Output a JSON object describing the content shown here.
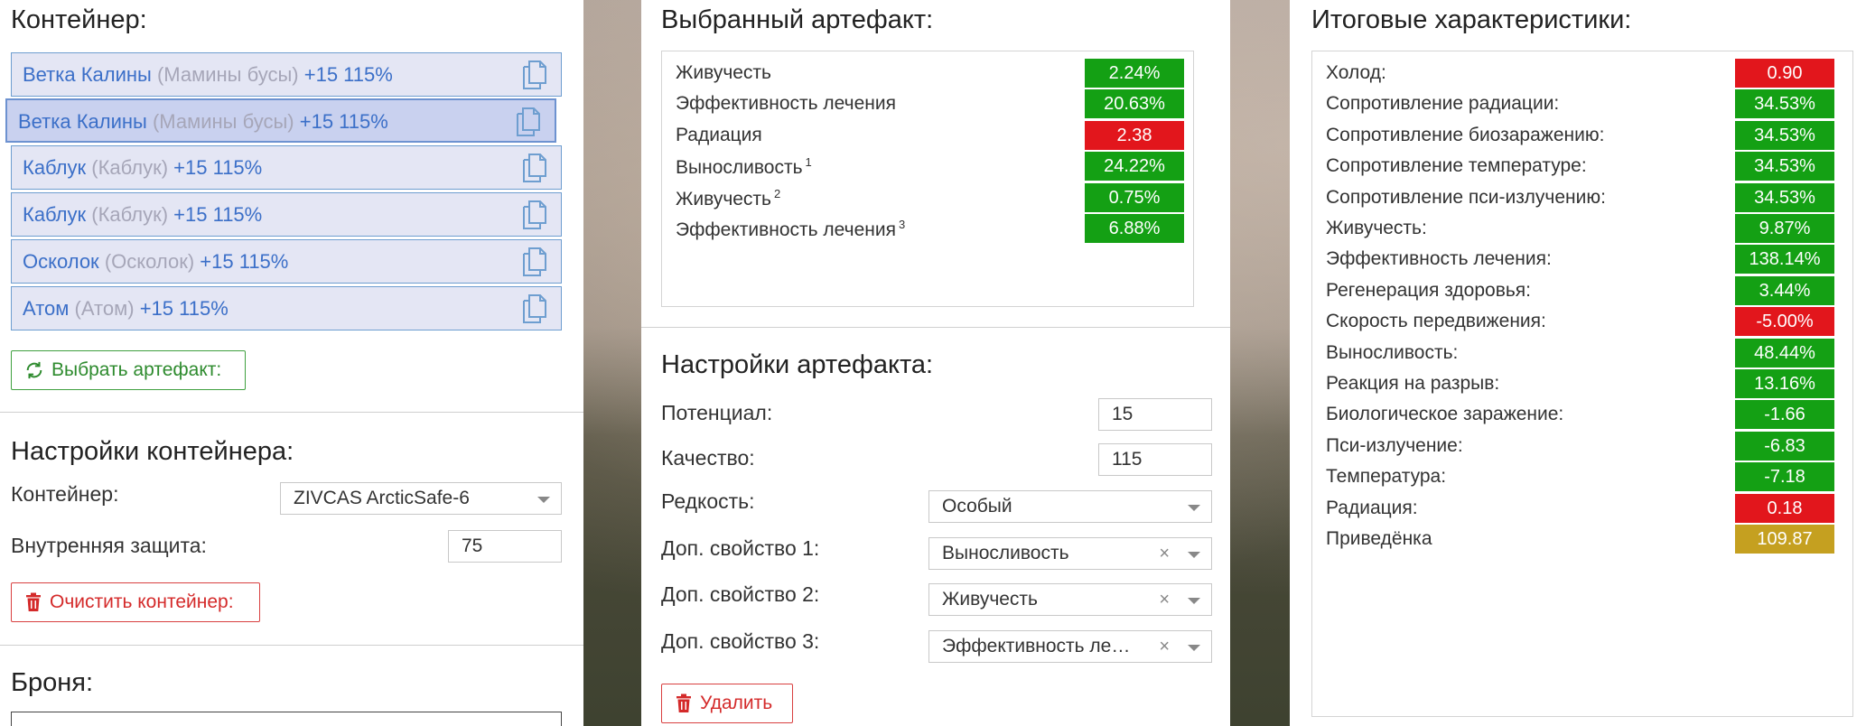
{
  "colors": {
    "positive": "#14a014",
    "negative": "#e2161c",
    "neutral": "#c5a020",
    "link": "#3b6fc8"
  },
  "container_panel": {
    "title": "Контейнер:",
    "items": [
      {
        "name": "Ветка Калины",
        "original": "(Мамины бусы)",
        "level": "+15 115%",
        "icon": "copy-icon"
      },
      {
        "name": "Ветка Калины",
        "original": "(Мамины бусы)",
        "level": "+15 115%",
        "icon": "copy-icon"
      },
      {
        "name": "Каблук",
        "original": "(Каблук)",
        "level": "+15 115%",
        "icon": "copy-icon"
      },
      {
        "name": "Каблук",
        "original": "(Каблук)",
        "level": "+15 115%",
        "icon": "copy-icon"
      },
      {
        "name": "Осколок",
        "original": "(Осколок)",
        "level": "+15 115%",
        "icon": "copy-icon"
      },
      {
        "name": "Атом",
        "original": "(Атом)",
        "level": "+15 115%",
        "icon": "copy-icon"
      }
    ],
    "select_button": "Выбрать артефакт:",
    "settings_title": "Настройки контейнера:",
    "container_label": "Контейнер:",
    "container_value": "ZIVCAS ArcticSafe-6",
    "protection_label": "Внутренняя защита:",
    "protection_value": "75",
    "clear_button": "Очистить контейнер:",
    "armor_title": "Броня:"
  },
  "artifact_panel": {
    "title": "Выбранный артефакт:",
    "stats": [
      {
        "name": "Живучесть",
        "sup": "",
        "value": "2.24%",
        "tone": "g"
      },
      {
        "name": "Эффективность лечения",
        "sup": "",
        "value": "20.63%",
        "tone": "g"
      },
      {
        "name": "Радиация",
        "sup": "",
        "value": "2.38",
        "tone": "r"
      },
      {
        "name": "Выносливость",
        "sup": "1",
        "value": "24.22%",
        "tone": "g"
      },
      {
        "name": "Живучесть",
        "sup": "2",
        "value": "0.75%",
        "tone": "g"
      },
      {
        "name": "Эффективность лечения",
        "sup": "3",
        "value": "6.88%",
        "tone": "g"
      }
    ],
    "settings_title": "Настройки артефакта:",
    "potential_label": "Потенциал:",
    "potential_value": "15",
    "quality_label": "Качество:",
    "quality_value": "115",
    "rarity_label": "Редкость:",
    "rarity_value": "Особый",
    "prop1_label": "Доп. свойство 1:",
    "prop1_value": "Выносливость",
    "prop2_label": "Доп. свойство 2:",
    "prop2_value": "Живучесть",
    "prop3_label": "Доп. свойство 3:",
    "prop3_value": "Эффективность ле…",
    "clear_x": "×",
    "delete_button": "Удалить"
  },
  "totals_panel": {
    "title": "Итоговые характеристики:",
    "stats": [
      {
        "name": "Холод:",
        "value": "0.90",
        "tone": "r"
      },
      {
        "name": "Сопротивление радиации:",
        "value": "34.53%",
        "tone": "g"
      },
      {
        "name": "Сопротивление биозаражению:",
        "value": "34.53%",
        "tone": "g"
      },
      {
        "name": "Сопротивление температуре:",
        "value": "34.53%",
        "tone": "g"
      },
      {
        "name": "Сопротивление пси-излучению:",
        "value": "34.53%",
        "tone": "g"
      },
      {
        "name": "Живучесть:",
        "value": "9.87%",
        "tone": "g"
      },
      {
        "name": "Эффективность лечения:",
        "value": "138.14%",
        "tone": "g"
      },
      {
        "name": "Регенерация здоровья:",
        "value": "3.44%",
        "tone": "g"
      },
      {
        "name": "Скорость передвижения:",
        "value": "-5.00%",
        "tone": "r"
      },
      {
        "name": "Выносливость:",
        "value": "48.44%",
        "tone": "g"
      },
      {
        "name": "Реакция на разрыв:",
        "value": "13.16%",
        "tone": "g"
      },
      {
        "name": "Биологическое заражение:",
        "value": "-1.66",
        "tone": "g"
      },
      {
        "name": "Пси-излучение:",
        "value": "-6.83",
        "tone": "g"
      },
      {
        "name": "Температура:",
        "value": "-7.18",
        "tone": "g"
      },
      {
        "name": "Радиация:",
        "value": "0.18",
        "tone": "r"
      },
      {
        "name": "Приведёнка",
        "value": "109.87",
        "tone": "y"
      }
    ]
  }
}
